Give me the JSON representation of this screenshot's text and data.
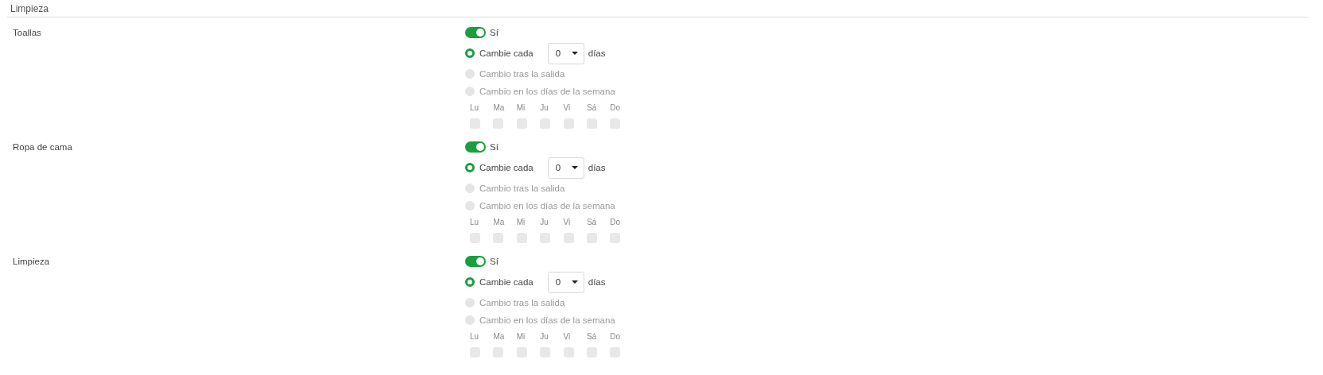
{
  "section_title": "Limpieza",
  "items": [
    {
      "label": "Toallas",
      "toggle": {
        "on": true,
        "text": "Sí"
      },
      "options": [
        {
          "kind": "interval",
          "label": "Cambie cada",
          "selected": true,
          "disabled": false,
          "value": "0",
          "unit": "días"
        },
        {
          "kind": "plain",
          "label": "Cambio tras la salida",
          "selected": false,
          "disabled": true
        },
        {
          "kind": "plain",
          "label": "Cambio en los días de la semana",
          "selected": false,
          "disabled": true
        }
      ],
      "days": [
        {
          "label": "Lu",
          "checked": false,
          "disabled": true
        },
        {
          "label": "Ma",
          "checked": false,
          "disabled": true
        },
        {
          "label": "Mi",
          "checked": false,
          "disabled": true
        },
        {
          "label": "Ju",
          "checked": false,
          "disabled": true
        },
        {
          "label": "Vi",
          "checked": false,
          "disabled": true
        },
        {
          "label": "Sá",
          "checked": false,
          "disabled": true
        },
        {
          "label": "Do",
          "checked": false,
          "disabled": true
        }
      ]
    },
    {
      "label": "Ropa de cama",
      "toggle": {
        "on": true,
        "text": "Sí"
      },
      "options": [
        {
          "kind": "interval",
          "label": "Cambie cada",
          "selected": true,
          "disabled": false,
          "value": "0",
          "unit": "días"
        },
        {
          "kind": "plain",
          "label": "Cambio tras la salida",
          "selected": false,
          "disabled": true
        },
        {
          "kind": "plain",
          "label": "Cambio en los días de la semana",
          "selected": false,
          "disabled": true
        }
      ],
      "days": [
        {
          "label": "Lu",
          "checked": false,
          "disabled": true
        },
        {
          "label": "Ma",
          "checked": false,
          "disabled": true
        },
        {
          "label": "Mi",
          "checked": false,
          "disabled": true
        },
        {
          "label": "Ju",
          "checked": false,
          "disabled": true
        },
        {
          "label": "Vi",
          "checked": false,
          "disabled": true
        },
        {
          "label": "Sá",
          "checked": false,
          "disabled": true
        },
        {
          "label": "Do",
          "checked": false,
          "disabled": true
        }
      ]
    },
    {
      "label": "Limpieza",
      "toggle": {
        "on": true,
        "text": "Sí"
      },
      "options": [
        {
          "kind": "interval",
          "label": "Cambie cada",
          "selected": true,
          "disabled": false,
          "value": "0",
          "unit": "días"
        },
        {
          "kind": "plain",
          "label": "Cambio tras la salida",
          "selected": false,
          "disabled": true
        },
        {
          "kind": "plain",
          "label": "Cambio en los días de la semana",
          "selected": false,
          "disabled": true
        }
      ],
      "days": [
        {
          "label": "Lu",
          "checked": false,
          "disabled": true
        },
        {
          "label": "Ma",
          "checked": false,
          "disabled": true
        },
        {
          "label": "Mi",
          "checked": false,
          "disabled": true
        },
        {
          "label": "Ju",
          "checked": false,
          "disabled": true
        },
        {
          "label": "Vi",
          "checked": false,
          "disabled": true
        },
        {
          "label": "Sá",
          "checked": false,
          "disabled": true
        },
        {
          "label": "Do",
          "checked": false,
          "disabled": true
        }
      ]
    }
  ]
}
